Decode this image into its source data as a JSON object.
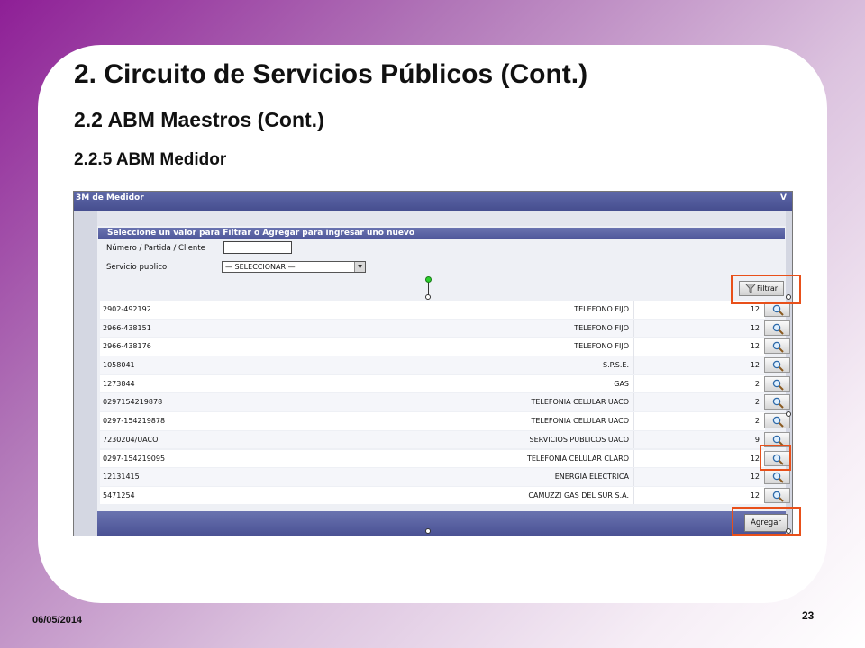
{
  "slide": {
    "title": "2. Circuito de Servicios Públicos (Cont.)",
    "subtitle": "2.2 ABM Maestros (Cont.)",
    "section": "2.2.5 ABM Medidor",
    "date": "06/05/2014",
    "page_number": "23",
    "highlight_color": "#e8501a"
  },
  "app": {
    "window_title": "3M de Medidor",
    "window_title_right": "V",
    "panel_title": "Seleccione un valor para Filtrar o Agregar para ingresar uno nuevo",
    "filters": {
      "number_label": "Número / Partida / Cliente",
      "number_value": "",
      "service_label": "Servicio publico",
      "service_selected": "— SELECCIONAR —"
    },
    "filter_button_label": "Filtrar",
    "add_button_label": "Agregar",
    "rows": [
      {
        "number": "2902-492192",
        "service": "TELEFONO FIJO",
        "code": "12"
      },
      {
        "number": "2966-438151",
        "service": "TELEFONO FIJO",
        "code": "12"
      },
      {
        "number": "2966-438176",
        "service": "TELEFONO FIJO",
        "code": "12"
      },
      {
        "number": "1058041",
        "service": "S.P.S.E.",
        "code": "12"
      },
      {
        "number": "1273844",
        "service": "GAS",
        "code": "2"
      },
      {
        "number": "0297154219878",
        "service": "TELEFONIA CELULAR UACO",
        "code": "2"
      },
      {
        "number": "0297-154219878",
        "service": "TELEFONIA CELULAR UACO",
        "code": "2"
      },
      {
        "number": "7230204/UACO",
        "service": "SERVICIOS PUBLICOS UACO",
        "code": "9"
      },
      {
        "number": "0297-154219095",
        "service": "TELEFONIA CELULAR CLARO",
        "code": "12"
      },
      {
        "number": "12131415",
        "service": "ENERGIA ELECTRICA",
        "code": "12"
      },
      {
        "number": "5471254",
        "service": "CAMUZZI GAS DEL SUR S.A.",
        "code": "12"
      }
    ]
  }
}
